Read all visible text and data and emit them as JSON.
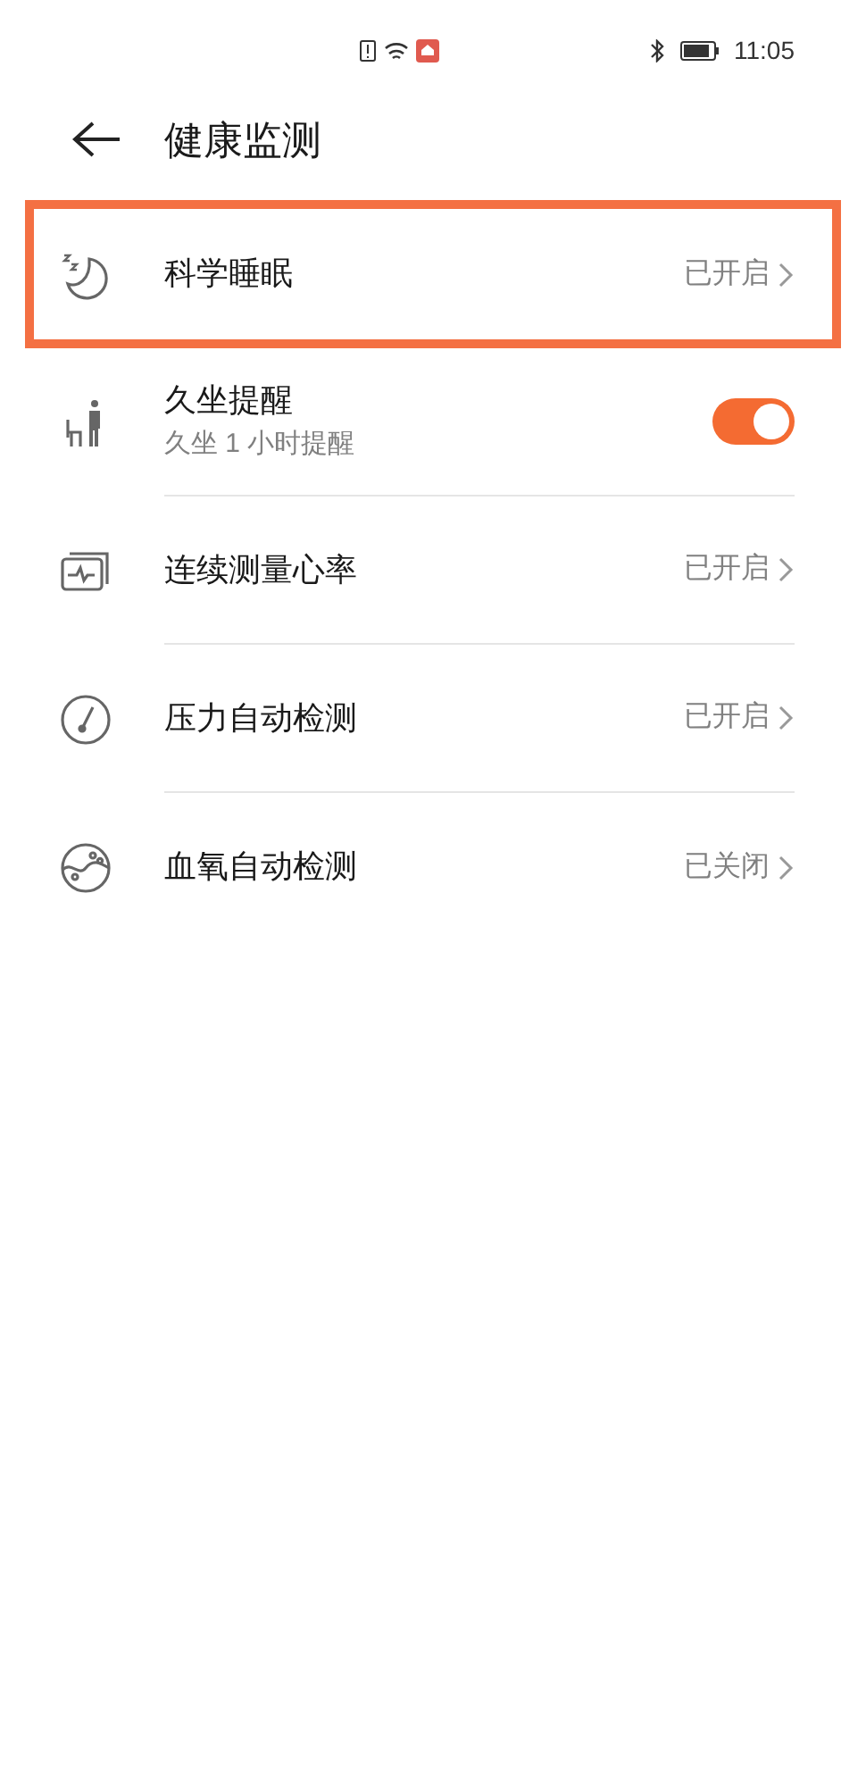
{
  "status_bar": {
    "time": "11:05"
  },
  "header": {
    "title": "健康监测"
  },
  "items": [
    {
      "kind": "link",
      "title": "科学睡眠",
      "value": "已开启",
      "highlighted": true
    },
    {
      "kind": "toggle",
      "title": "久坐提醒",
      "subtitle": "久坐 1 小时提醒",
      "on": true,
      "highlighted": false
    },
    {
      "kind": "link",
      "title": "连续测量心率",
      "value": "已开启",
      "highlighted": false
    },
    {
      "kind": "link",
      "title": "压力自动检测",
      "value": "已开启",
      "highlighted": false
    },
    {
      "kind": "link",
      "title": "血氧自动检测",
      "value": "已关闭",
      "highlighted": false
    }
  ]
}
